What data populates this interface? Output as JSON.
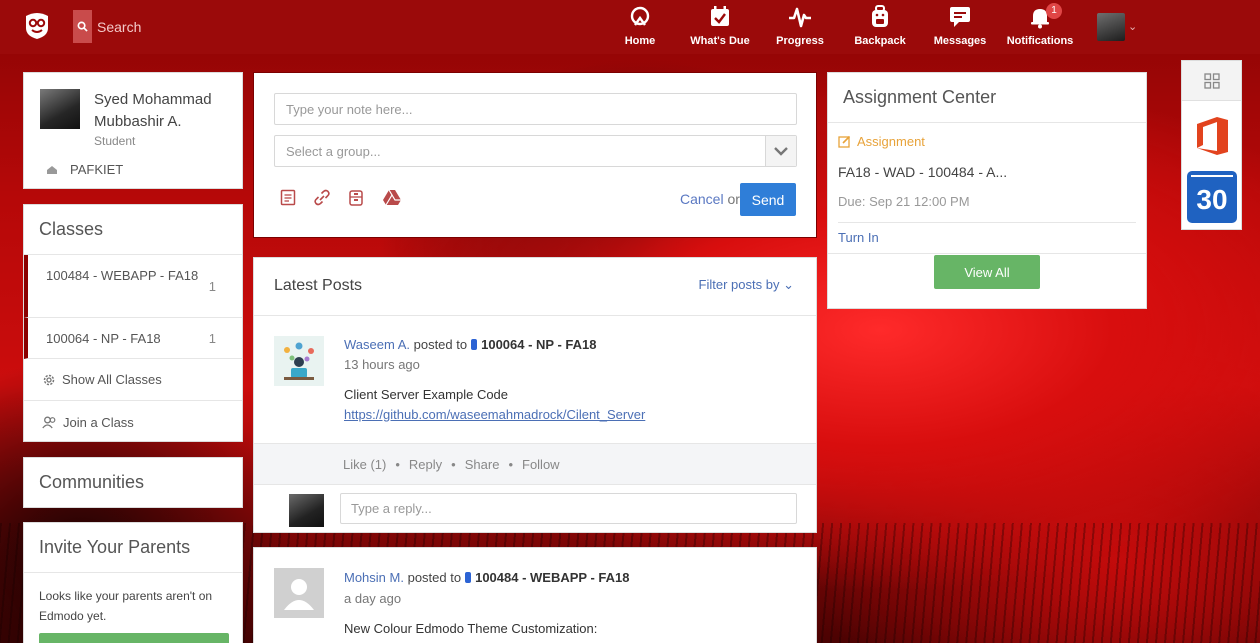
{
  "topbar": {
    "search_label": "Search",
    "nav": [
      {
        "label": "Home",
        "icon": "home-icon"
      },
      {
        "label": "What's Due",
        "icon": "calendar-check-icon"
      },
      {
        "label": "Progress",
        "icon": "pulse-icon"
      },
      {
        "label": "Backpack",
        "icon": "backpack-icon"
      },
      {
        "label": "Messages",
        "icon": "message-icon"
      },
      {
        "label": "Notifications",
        "icon": "bell-icon",
        "badge": "1"
      }
    ]
  },
  "profile": {
    "name": "Syed Mohammad Mubbashir A.",
    "role": "Student",
    "school": "PAFKIET"
  },
  "classes": {
    "title": "Classes",
    "items": [
      {
        "label": "100484 - WEBAPP - FA18",
        "count": "1"
      },
      {
        "label": "100064 - NP - FA18",
        "count": "1"
      }
    ],
    "show_all": "Show All Classes",
    "join": "Join a Class"
  },
  "communities": {
    "title": "Communities"
  },
  "invite": {
    "title": "Invite Your Parents",
    "body": "Looks like your parents aren't on Edmodo yet."
  },
  "composer": {
    "note_placeholder": "Type your note here...",
    "group_placeholder": "Select a group...",
    "cancel": "Cancel",
    "or": "or",
    "send": "Send"
  },
  "posts": {
    "title": "Latest Posts",
    "filter": "Filter posts by",
    "items": [
      {
        "author": "Waseem A.",
        "posted_to": "posted to",
        "group": "100064 - NP - FA18",
        "time": "13 hours ago",
        "text": "Client Server Example Code",
        "link": "https://github.com/waseemahmadrock/Cilent_Server",
        "actions": [
          "Like (1)",
          "Reply",
          "Share",
          "Follow"
        ],
        "reply_placeholder": "Type a reply..."
      },
      {
        "author": "Mohsin M.",
        "posted_to": "posted to",
        "group": "100484 - WEBAPP - FA18",
        "time": "a day ago",
        "text": "New Colour Edmodo Theme Customization:"
      }
    ]
  },
  "assignment_center": {
    "title": "Assignment Center",
    "type": "Assignment",
    "item_title": "FA18 - WAD - 100484 - A...",
    "due": "Due: Sep 21 12:00 PM",
    "turn_in": "Turn In",
    "view_all": "View All"
  },
  "apps": {
    "calendar_day": "30"
  },
  "colors": {
    "topbar": "#9b0a0a",
    "link": "#4b6fb5",
    "primary_button": "#2f7ed8",
    "green_button": "#67b566",
    "assignment_accent": "#e8a33a"
  }
}
